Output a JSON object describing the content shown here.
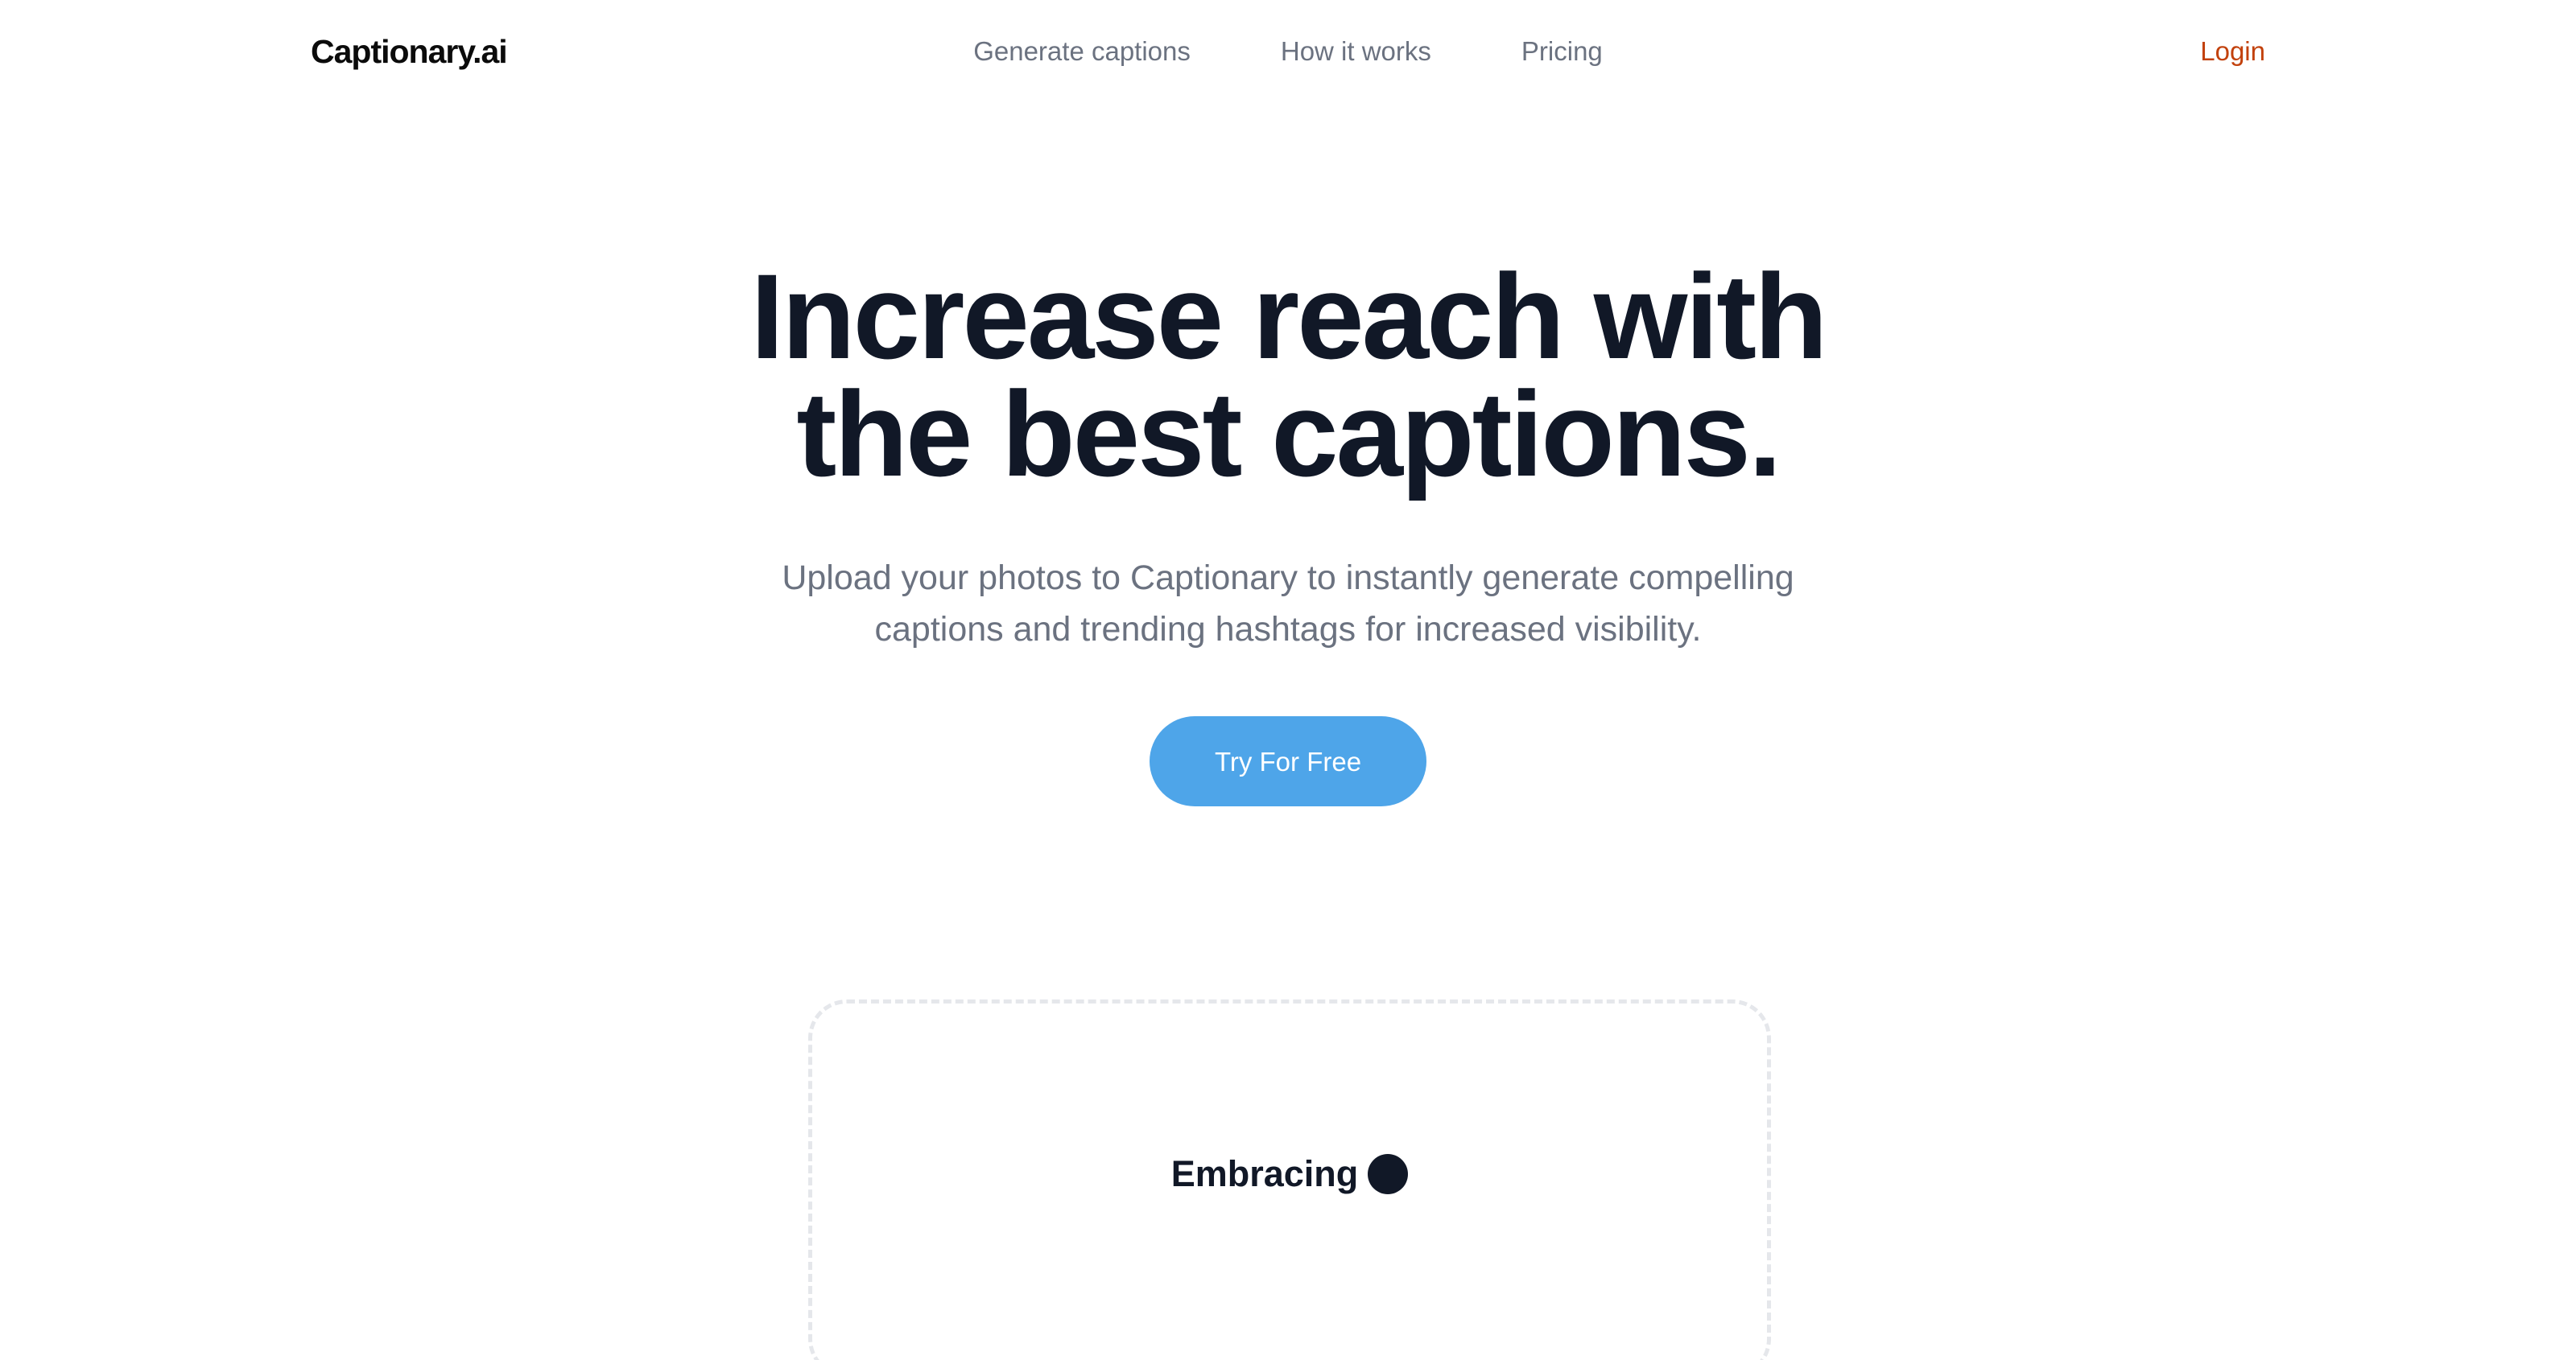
{
  "header": {
    "logo": "Captionary.ai",
    "nav": [
      {
        "label": "Generate captions"
      },
      {
        "label": "How it works"
      },
      {
        "label": "Pricing"
      }
    ],
    "login_label": "Login"
  },
  "hero": {
    "headline_line1": "Increase reach with",
    "headline_line2": "the best captions.",
    "subtitle": "Upload your photos to Captionary to instantly generate compelling captions and trending hashtags for increased visibility.",
    "cta_label": "Try For Free"
  },
  "demo": {
    "status_text": "Embracing",
    "status_indicator": "loading-dot-icon"
  },
  "colors": {
    "heading": "#111827",
    "muted": "#6b7280",
    "login": "#c2410c",
    "cta": "#4ea5e9",
    "dashed_border": "#e5e7eb"
  }
}
